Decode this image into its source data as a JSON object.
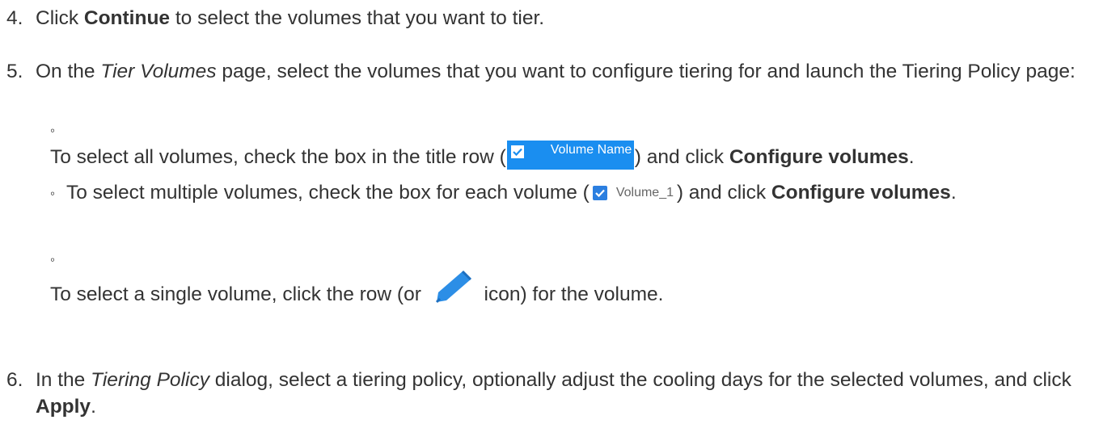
{
  "steps": {
    "s4": {
      "num": "4.",
      "t1": "Click ",
      "b1": "Continue",
      "t2": " to select the volumes that you want to tier."
    },
    "s5": {
      "num": "5.",
      "t1": "On the ",
      "i1": "Tier Volumes",
      "t2": " page, select the volumes that you want to configure tiering for and launch the Tiering Policy page:"
    },
    "s6": {
      "num": "6.",
      "t1": "In the ",
      "i1": "Tiering Policy",
      "t2": " dialog, select a tiering policy, optionally adjust the cooling days for the selected volumes, and click ",
      "b1": "Apply",
      "t3": "."
    }
  },
  "subs": {
    "bullet": "◦",
    "a": {
      "t1": "To select all volumes, check the box in the title row (",
      "t2": ") and click ",
      "b1": "Configure volumes",
      "t3": "."
    },
    "b": {
      "t1": "To select multiple volumes, check the box for each volume (",
      "t2": ") and click ",
      "b1": "Configure volumes",
      "t3": "."
    },
    "c": {
      "t1": "To select a single volume, click the row (or ",
      "t2": " icon) for the volume."
    }
  },
  "widgets": {
    "header_label": "Volume Name",
    "row_label": "Volume_1",
    "accent": "#1a8ef0",
    "checkbox_blue": "#2b7fe0",
    "icons": [
      "checkbox-checked-icon",
      "pencil-edit-icon"
    ]
  }
}
